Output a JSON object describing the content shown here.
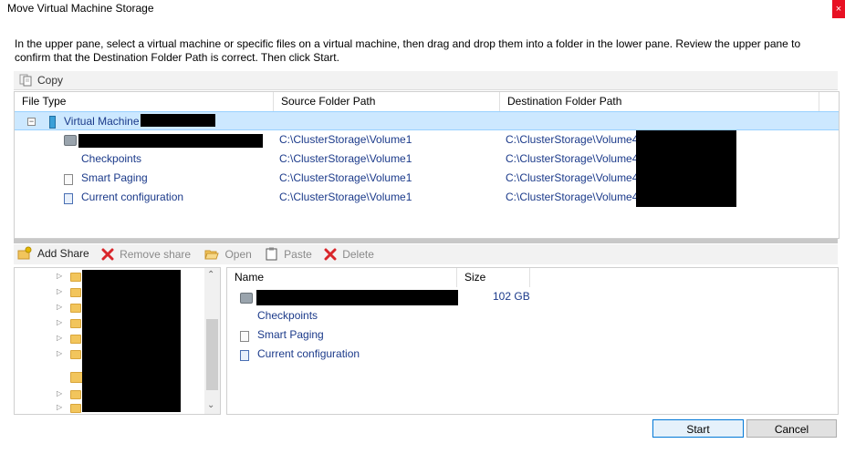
{
  "window": {
    "title": "Move Virtual Machine Storage",
    "close_glyph": "×"
  },
  "instructions": "In the upper pane, select a virtual machine or specific files on a virtual machine, then drag and drop them into a folder in the lower pane.  Review the upper pane to confirm that the Destination Folder Path is correct. Then click Start.",
  "upper_toolbar": {
    "copy_label": "Copy"
  },
  "upper_table": {
    "columns": [
      "File Type",
      "Source Folder Path",
      "Destination Folder Path"
    ],
    "vm_label": "Virtual Machine",
    "expand_glyph": "−",
    "rows": [
      {
        "name": "",
        "source": "C:\\ClusterStorage\\Volume1",
        "dest": "C:\\ClusterStorage\\Volume4"
      },
      {
        "name": "Checkpoints",
        "source": "C:\\ClusterStorage\\Volume1",
        "dest": "C:\\ClusterStorage\\Volume4"
      },
      {
        "name": "Smart Paging",
        "source": "C:\\ClusterStorage\\Volume1",
        "dest": "C:\\ClusterStorage\\Volume4"
      },
      {
        "name": "Current configuration",
        "source": "C:\\ClusterStorage\\Volume1",
        "dest": "C:\\ClusterStorage\\Volume4"
      }
    ]
  },
  "lower_toolbar": {
    "add_share": "Add Share",
    "remove_share": "Remove share",
    "open": "Open",
    "paste": "Paste",
    "delete": "Delete"
  },
  "files_table": {
    "columns": [
      "Name",
      "Size"
    ],
    "rows": [
      {
        "name": "",
        "size": "102 GB"
      },
      {
        "name": "Checkpoints",
        "size": ""
      },
      {
        "name": "Smart Paging",
        "size": ""
      },
      {
        "name": "Current configuration",
        "size": ""
      }
    ]
  },
  "tree": {
    "expand_glyph": "▷",
    "scroll_up_glyph": "⌃",
    "scroll_down_glyph": "⌄"
  },
  "buttons": {
    "start": "Start",
    "cancel": "Cancel"
  },
  "colors": {
    "selection": "#cce8ff",
    "link_text": "#1b3a8a",
    "close": "#e81123",
    "remove_icon": "#d9262b"
  }
}
